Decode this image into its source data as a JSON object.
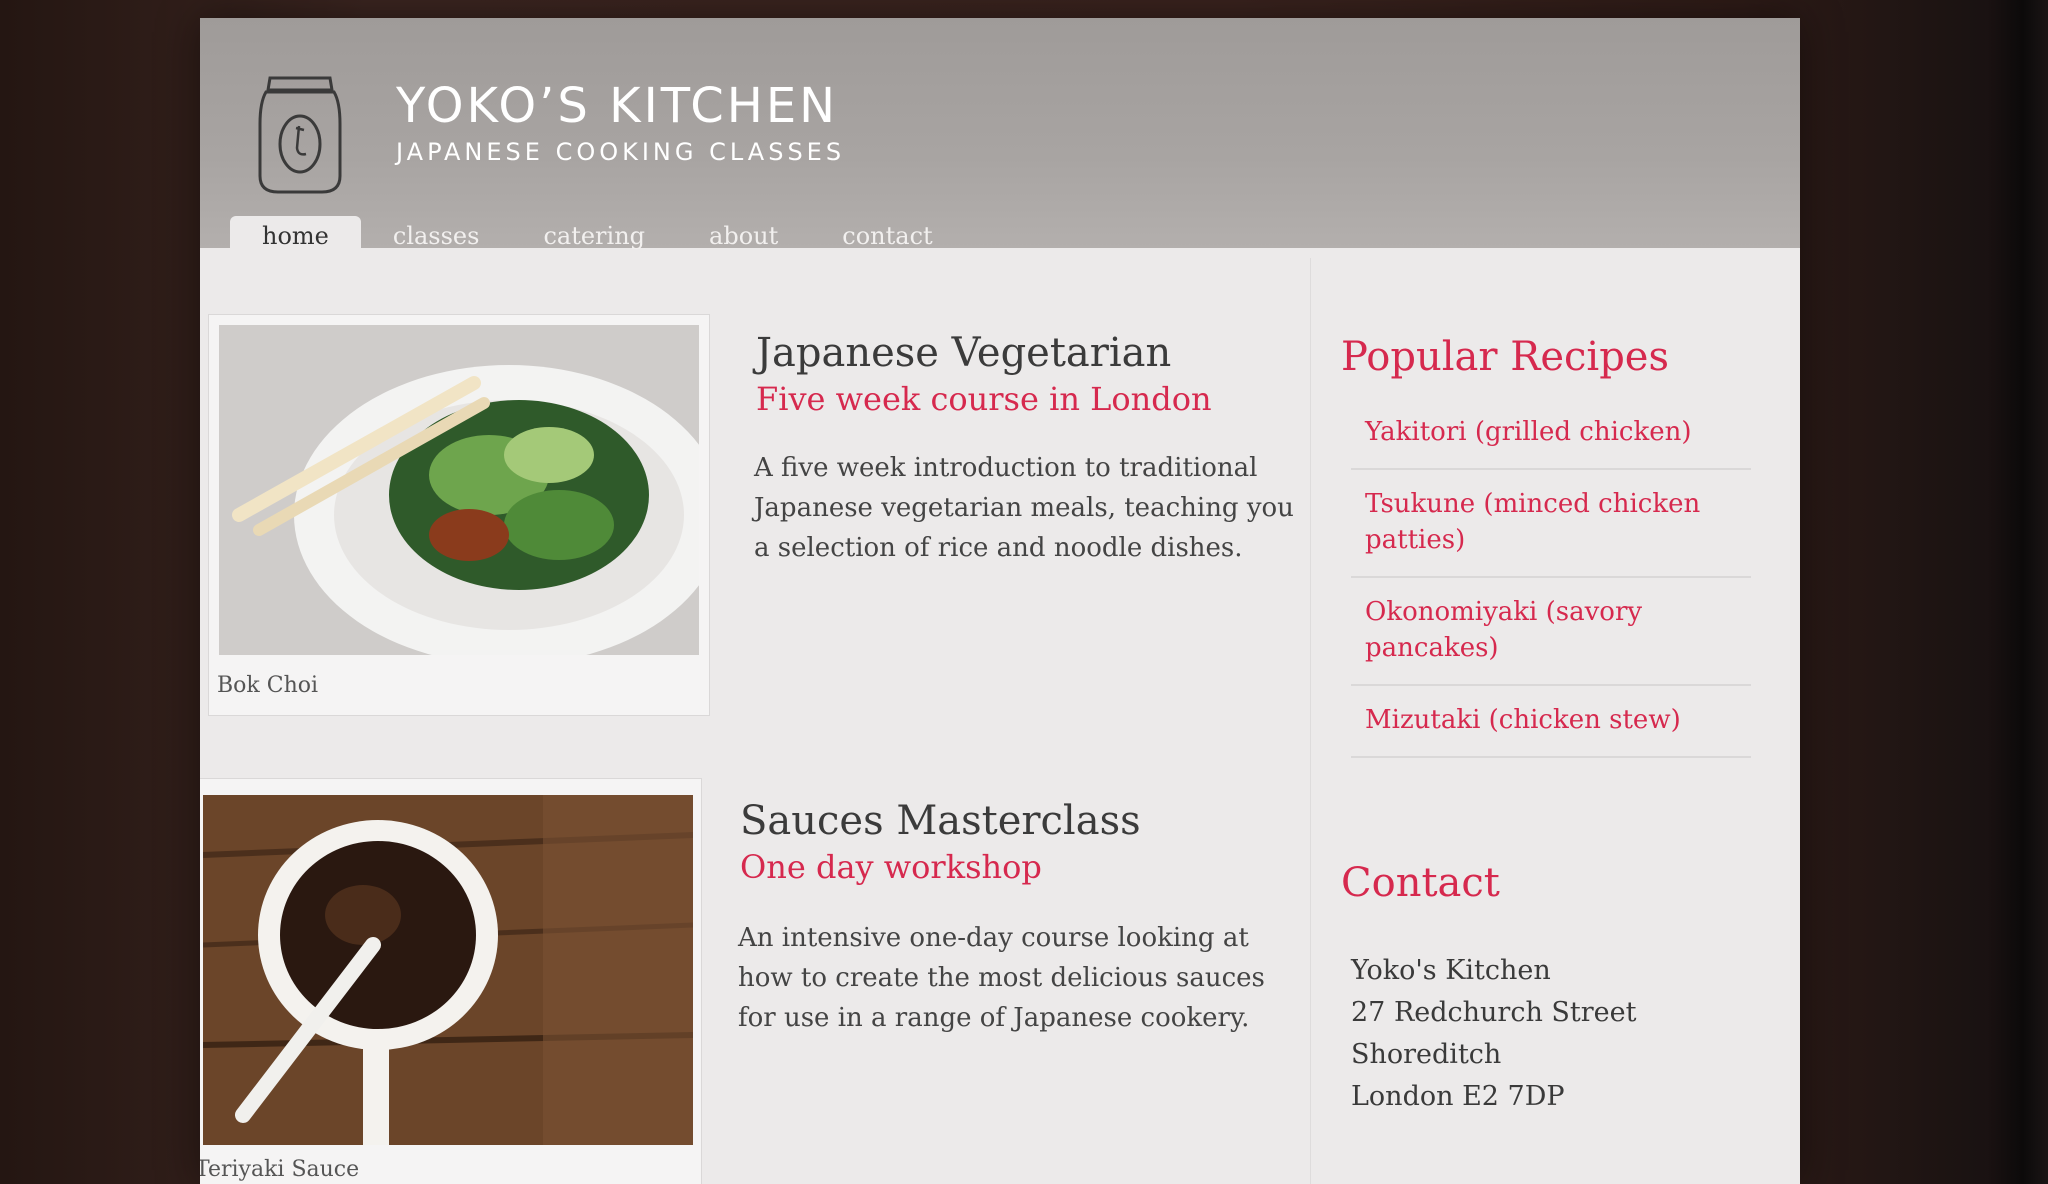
{
  "brand": {
    "title": "YOKO’S KITCHEN",
    "subtitle": "JAPANESE COOKING CLASSES"
  },
  "nav": {
    "items": [
      "home",
      "classes",
      "catering",
      "about",
      "contact"
    ],
    "active": "home"
  },
  "courses": [
    {
      "title": "Japanese Vegetarian",
      "subtitle": "Five week course in London",
      "description": "A five week introduction to traditional Japanese vegetarian meals, teaching you a selection of rice and noodle dishes.",
      "caption": "Bok Choi"
    },
    {
      "title": "Sauces Masterclass",
      "subtitle": "One day workshop",
      "description": "An intensive one-day course looking at how to create the most delicious sauces for use in a range of Japanese cookery.",
      "caption": "Teriyaki Sauce"
    }
  ],
  "sidebar": {
    "recipes_heading": "Popular Recipes",
    "recipes": [
      "Yakitori (grilled chicken)",
      "Tsukune (minced chicken patties)",
      "Okonomiyaki (savory pancakes)",
      "Mizutaki (chicken stew)"
    ],
    "contact_heading": "Contact",
    "address": [
      "Yoko's Kitchen",
      "27 Redchurch Street",
      "Shoreditch",
      "London E2 7DP"
    ]
  },
  "colors": {
    "accent": "#d6294e",
    "header_bg": "#a6a2a0",
    "page_bg": "#eceaea"
  }
}
